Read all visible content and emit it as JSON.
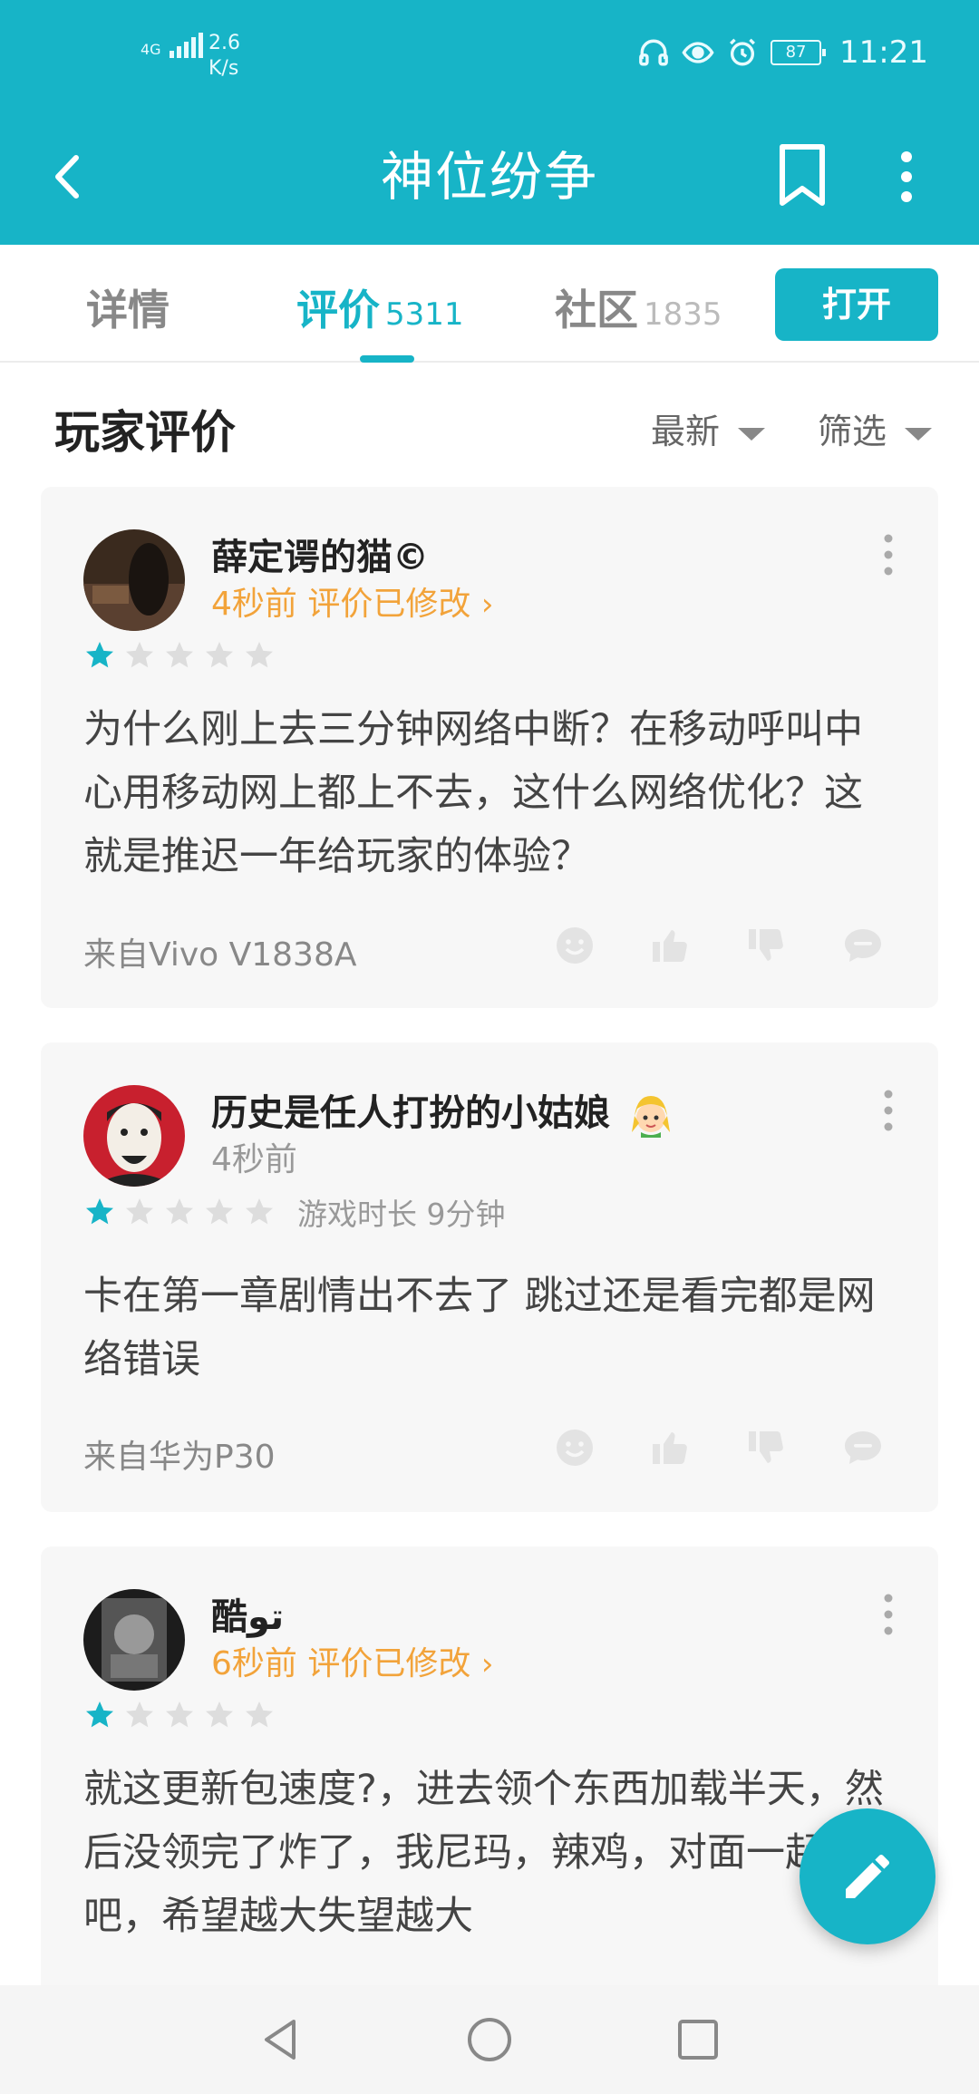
{
  "status_bar": {
    "network": "4G",
    "speed_value": "2.6",
    "speed_unit": "K/s",
    "battery": "87",
    "time": "11:21"
  },
  "app_bar": {
    "title": "神位纷争",
    "back_icon": "chevron-left-icon",
    "bookmark_icon": "bookmark-icon",
    "more_icon": "more-vertical-icon"
  },
  "tabs": [
    {
      "label": "详情",
      "count": ""
    },
    {
      "label": "评价",
      "count": "5311"
    },
    {
      "label": "社区",
      "count": "1835"
    }
  ],
  "active_tab": 1,
  "open_button": "打开",
  "section": {
    "title": "玩家评价",
    "sort_label": "最新",
    "filter_label": "筛选"
  },
  "reviews": [
    {
      "username": "薛定谔的猫©",
      "time": "4秒前",
      "modified": "评价已修改",
      "rating": 1,
      "max_rating": 5,
      "playtime": "",
      "content": "为什么刚上去三分钟网络中断？在移动呼叫中心用移动网上都上不去，这什么网络优化？这就是推迟一年给玩家的体验？",
      "device": "来自Vivo V1838A"
    },
    {
      "username": "历史是任人打扮的小姑娘",
      "time": "4秒前",
      "modified": "",
      "rating": 1,
      "max_rating": 5,
      "playtime": "游戏时长 9分钟",
      "content": "卡在第一章剧情出不去了 跳过还是看完都是网络错误",
      "device": "来自华为P30"
    },
    {
      "username": "酷تو",
      "time": "6秒前",
      "modified": "评价已修改",
      "rating": 1,
      "max_rating": 5,
      "playtime": "",
      "content": "就这更新包速度?，进去领个东西加载半天，然后没领完了炸了，我尼玛，辣鸡，对面一起凉吧，希望越大失望越大",
      "device": ""
    }
  ],
  "action_icons": [
    "smile-icon",
    "thumbs-up-icon",
    "thumbs-down-icon",
    "comment-icon"
  ],
  "colors": {
    "primary": "#17B4C7",
    "accent_orange": "#F2A33A",
    "card_bg": "#F7F7F7"
  }
}
